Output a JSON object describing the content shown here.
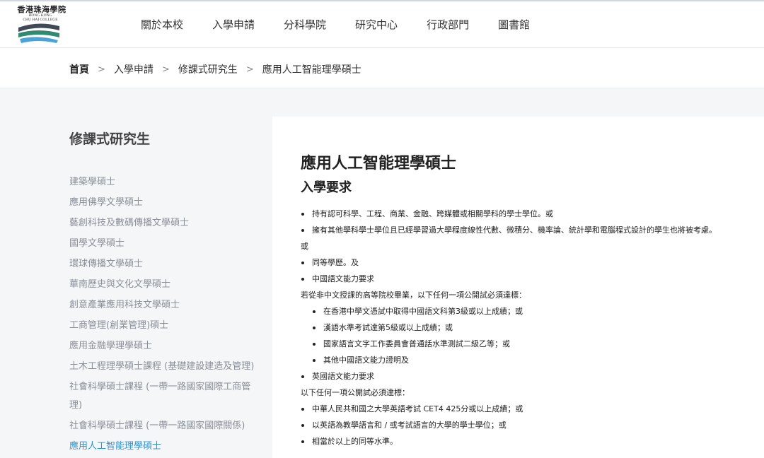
{
  "logo": {
    "name_cn": "香港珠海學院",
    "name_en_line1": "HONG KONG",
    "name_en_line2": "CHU HAI COLLEGE"
  },
  "nav": {
    "items": [
      "關於本校",
      "入學申請",
      "分科學院",
      "研究中心",
      "行政部門",
      "圖書館"
    ]
  },
  "breadcrumb": {
    "items": [
      "首頁",
      "入學申請",
      "修課式研究生",
      "應用人工智能理學碩士"
    ],
    "separator": ">"
  },
  "sidebar": {
    "title": "修課式研究生",
    "items": [
      "建築學碩士",
      "應用佛學文學碩士",
      "藝創科技及數碼傳播文學碩士",
      "國學文學碩士",
      "環球傳播文學碩士",
      "華南歷史與文化文學碩士",
      "創意產業應用科技文學碩士",
      "工商管理(創業管理)碩士",
      "應用金融學理學碩士",
      "土木工程理學碩士課程 (基礎建設建造及管理)",
      "社會科學碩士課程 (一帶一路國家國際工商管理)",
      "社會科學碩士課程 (一帶一路國家國際關係)",
      "應用人工智能理學碩士"
    ],
    "active_index": 12
  },
  "main": {
    "title": "應用人工智能理學碩士",
    "section_title": "入學要求",
    "requirements": [
      "持有認可科學、工程、商業、金融、跨媒體或相關學科的學士學位。或",
      "擁有其他學科學士學位且已經學習過大學程度線性代數、微積分、機率論、統計學和電腦程式設計的學生也將被考慮。",
      "或",
      "同等學歷。及",
      "中國語文能力要求",
      "若從非中文授課的高等院校畢業，以下任何一項公開試必須達標：",
      "在香港中學文憑試中取得中國語文科第3級或以上成績；或",
      "漢語水準考試達第5級或以上成績；或",
      "國家語言文字工作委員會普通話水準測試二級乙等；或",
      "其他中國語文能力證明及",
      "英國語文能力要求",
      "以下任何一項公開試必須達標：",
      "中華人民共和國之大學英語考試 CET4 425分或以上成績；或",
      "以英語為教學語言和 / 或考試語言的大學的學士學位；或",
      "相當於以上的同等水準。"
    ]
  },
  "colors": {
    "active_link": "#2c95d4",
    "sidebar_text": "#8a8f96",
    "page_bg": "#f4f6f8"
  }
}
